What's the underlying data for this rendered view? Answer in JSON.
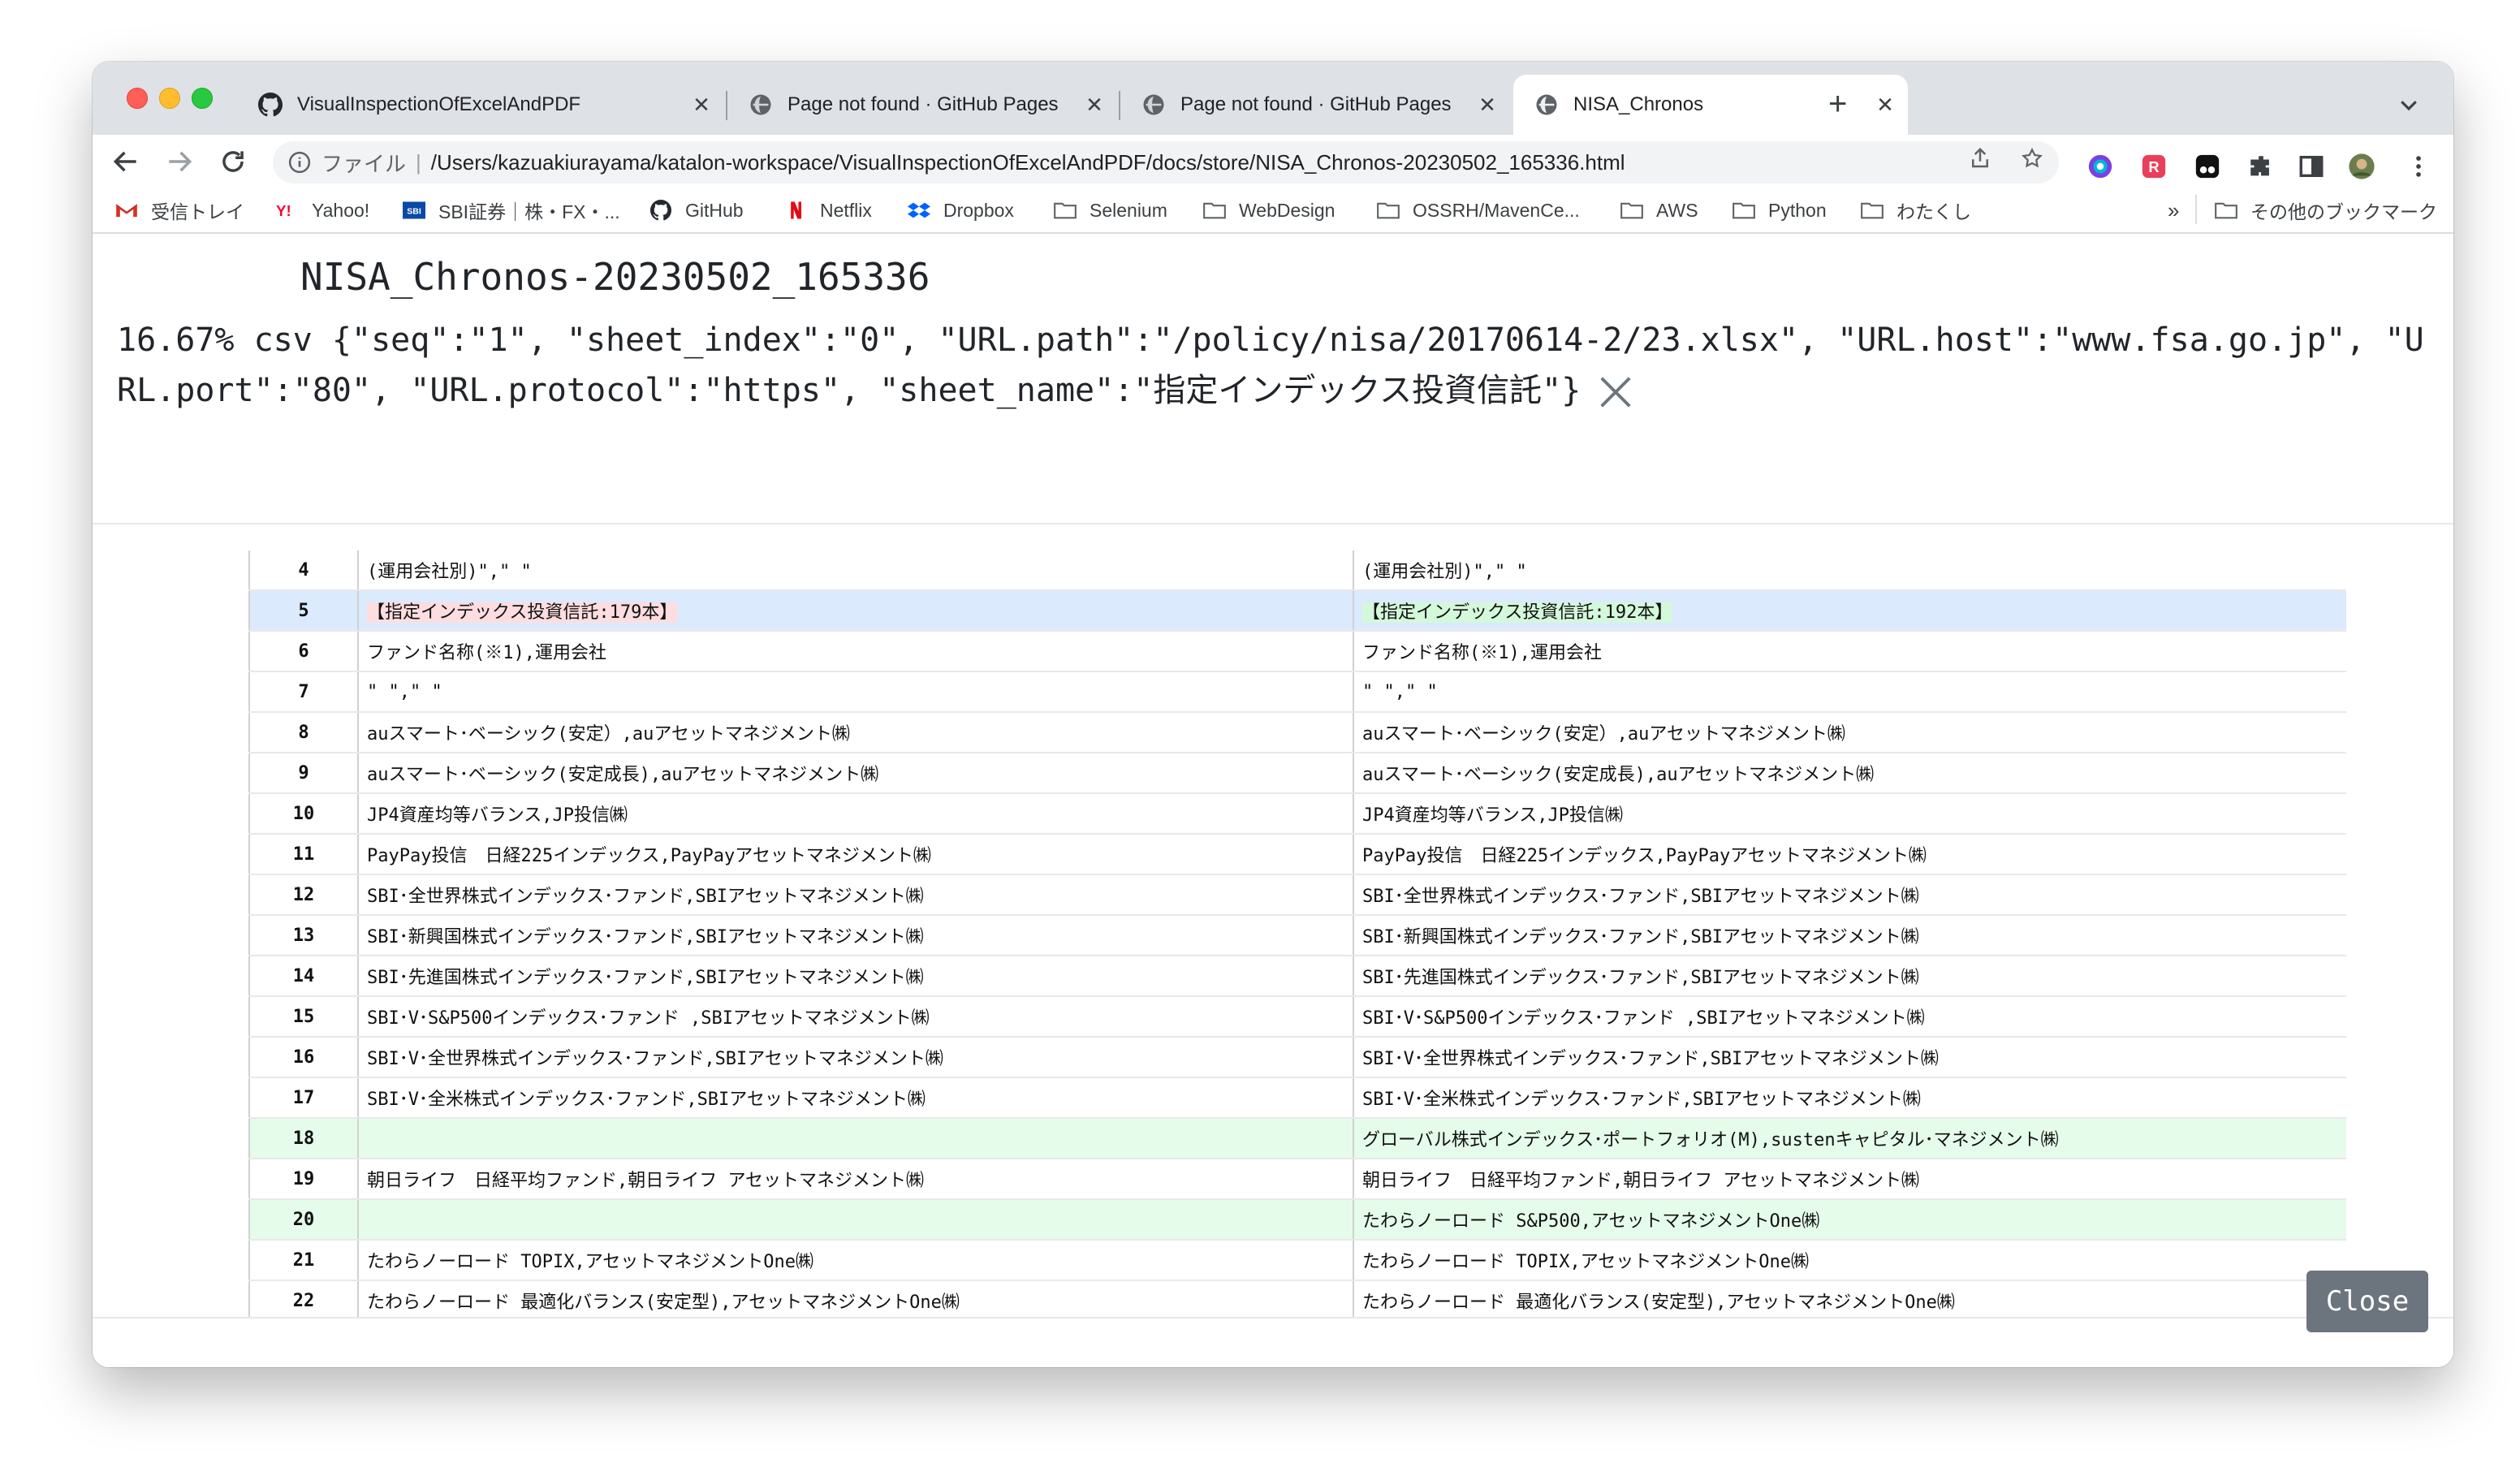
{
  "browser": {
    "tabs": [
      {
        "title": "VisualInspectionOfExcelAndPDF",
        "favicon": "github-icon",
        "active": false
      },
      {
        "title": "Page not found · GitHub Pages",
        "favicon": "globe-icon",
        "active": false
      },
      {
        "title": "Page not found · GitHub Pages",
        "favicon": "globe-icon",
        "active": false
      },
      {
        "title": "NISA_Chronos",
        "favicon": "globe-icon",
        "active": true
      }
    ],
    "tab_close_glyph": "✕",
    "new_tab_glyph": "+",
    "omnibox": {
      "scheme_label": "ファイル",
      "separator": "|",
      "url": "/Users/kazuakiurayama/katalon-workspace/VisualInspectionOfExcelAndPDF/docs/store/NISA_Chronos-20230502_165336.html"
    },
    "bookmarks": [
      {
        "label": "受信トレイ",
        "icon": "gmail-icon"
      },
      {
        "label": "Yahoo!",
        "icon": "yahoo-icon"
      },
      {
        "label": "SBI証券｜株・FX・...",
        "icon": "sbi-icon"
      },
      {
        "label": "GitHub",
        "icon": "github-icon"
      },
      {
        "label": "Netflix",
        "icon": "netflix-icon"
      },
      {
        "label": "Dropbox",
        "icon": "dropbox-icon"
      },
      {
        "label": "Selenium",
        "icon": "folder-icon"
      },
      {
        "label": "WebDesign",
        "icon": "folder-icon"
      },
      {
        "label": "OSSRH/MavenCe...",
        "icon": "folder-icon"
      },
      {
        "label": "AWS",
        "icon": "folder-icon"
      },
      {
        "label": "Python",
        "icon": "folder-icon"
      },
      {
        "label": "わたくし",
        "icon": "folder-icon"
      }
    ],
    "bookmarks_overflow": "»",
    "other_bookmarks": "その他のブックマーク"
  },
  "page": {
    "title": "NISA_Chronos-20230502_165336",
    "summary": "16.67% csv {\"seq\":\"1\", \"sheet_index\":\"0\", \"URL.path\":\"/policy/nisa/20170614-2/23.xlsx\", \"URL.host\":\"www.fsa.go.jp\", \"URL.port\":\"80\", \"URL.protocol\":\"https\", \"sheet_name\":\"指定インデックス投資信託\"}",
    "close_label": "Close"
  },
  "diff": {
    "rows": [
      {
        "num": "4",
        "left": "(運用会社別)\",\" \"",
        "right": "(運用会社別)\",\" \"",
        "status": "same"
      },
      {
        "num": "5",
        "left": "【指定インデックス投資信託:179本】",
        "right": "【指定インデックス投資信託:192本】",
        "status": "changed"
      },
      {
        "num": "6",
        "left": "ファンド名称(※1),運用会社",
        "right": "ファンド名称(※1),運用会社",
        "status": "same"
      },
      {
        "num": "7",
        "left": "\" \",\" \"",
        "right": "\" \",\" \"",
        "status": "same"
      },
      {
        "num": "8",
        "left": "auスマート･ベーシック(安定）,auアセットマネジメント㈱",
        "right": "auスマート･ベーシック(安定）,auアセットマネジメント㈱",
        "status": "same"
      },
      {
        "num": "9",
        "left": "auスマート･ベーシック(安定成長),auアセットマネジメント㈱",
        "right": "auスマート･ベーシック(安定成長),auアセットマネジメント㈱",
        "status": "same"
      },
      {
        "num": "10",
        "left": "JP4資産均等バランス,JP投信㈱",
        "right": "JP4資産均等バランス,JP投信㈱",
        "status": "same"
      },
      {
        "num": "11",
        "left": "PayPay投信　日経225インデックス,PayPayアセットマネジメント㈱",
        "right": "PayPay投信　日経225インデックス,PayPayアセットマネジメント㈱",
        "status": "same"
      },
      {
        "num": "12",
        "left": "SBI･全世界株式インデックス･ファンド,SBIアセットマネジメント㈱",
        "right": "SBI･全世界株式インデックス･ファンド,SBIアセットマネジメント㈱",
        "status": "same"
      },
      {
        "num": "13",
        "left": "SBI･新興国株式インデックス･ファンド,SBIアセットマネジメント㈱",
        "right": "SBI･新興国株式インデックス･ファンド,SBIアセットマネジメント㈱",
        "status": "same"
      },
      {
        "num": "14",
        "left": "SBI･先進国株式インデックス･ファンド,SBIアセットマネジメント㈱",
        "right": "SBI･先進国株式インデックス･ファンド,SBIアセットマネジメント㈱",
        "status": "same"
      },
      {
        "num": "15",
        "left": "SBI･V･S&P500インデックス･ファンド ,SBIアセットマネジメント㈱",
        "right": "SBI･V･S&P500インデックス･ファンド ,SBIアセットマネジメント㈱",
        "status": "same"
      },
      {
        "num": "16",
        "left": "SBI･V･全世界株式インデックス･ファンド,SBIアセットマネジメント㈱",
        "right": "SBI･V･全世界株式インデックス･ファンド,SBIアセットマネジメント㈱",
        "status": "same"
      },
      {
        "num": "17",
        "left": "SBI･V･全米株式インデックス･ファンド,SBIアセットマネジメント㈱",
        "right": "SBI･V･全米株式インデックス･ファンド,SBIアセットマネジメント㈱",
        "status": "same"
      },
      {
        "num": "18",
        "left": "",
        "right": "グローバル株式インデックス･ポートフォリオ(M),sustenキャピタル･マネジメント㈱",
        "status": "added"
      },
      {
        "num": "19",
        "left": "朝日ライフ　日経平均ファンド,朝日ライフ アセットマネジメント㈱",
        "right": "朝日ライフ　日経平均ファンド,朝日ライフ アセットマネジメント㈱",
        "status": "same"
      },
      {
        "num": "20",
        "left": "",
        "right": "たわらノーロード S&P500,アセットマネジメントOne㈱",
        "status": "added"
      },
      {
        "num": "21",
        "left": "たわらノーロード TOPIX,アセットマネジメントOne㈱",
        "right": "たわらノーロード TOPIX,アセットマネジメントOne㈱",
        "status": "same"
      },
      {
        "num": "22",
        "left": "たわらノーロード 最適化バランス(安定型),アセットマネジメントOne㈱",
        "right": "たわらノーロード 最適化バランス(安定型),アセットマネジメントOne㈱",
        "status": "same"
      }
    ]
  },
  "colors": {
    "changed_row": "#dbeafd",
    "deleted_text": "#fddde0",
    "added_text": "#d4f8da",
    "added_row": "#e6fcea",
    "close_button": "#6c757d"
  }
}
